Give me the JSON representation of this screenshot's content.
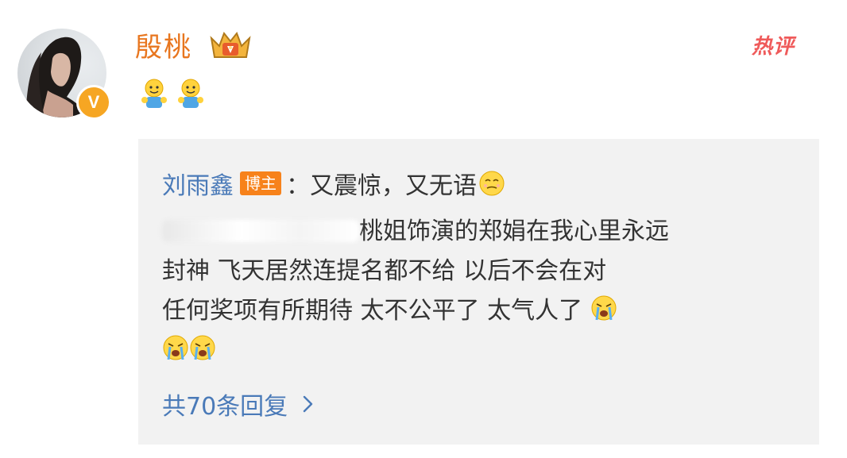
{
  "post": {
    "author": "殷桃",
    "hot_label": "热评",
    "avatar_badge": "V",
    "emojis": [
      "hug-figure-icon",
      "hug-figure-icon"
    ]
  },
  "reply": {
    "replier": "刘雨鑫",
    "blogger_tag": "博主",
    "colon": "：",
    "short_text": "又震惊，又无语",
    "short_emoji": "speechless-face-icon",
    "body_line1": "桃姐饰演的郑娟在我心里永远",
    "body_line2": "封神 飞天居然连提名都不给 以后不会在对",
    "body_line3": "任何奖项有所期待 太不公平了 太气人了",
    "cry_emojis": [
      "crying-face-icon",
      "crying-face-icon",
      "crying-face-icon"
    ],
    "more_replies": "共70条回复"
  },
  "colors": {
    "author": "#e8761f",
    "link": "#4a7ab8",
    "hot": "#ef5a5a",
    "tag_bg": "#f7821b",
    "panel_bg": "#f2f2f2"
  }
}
